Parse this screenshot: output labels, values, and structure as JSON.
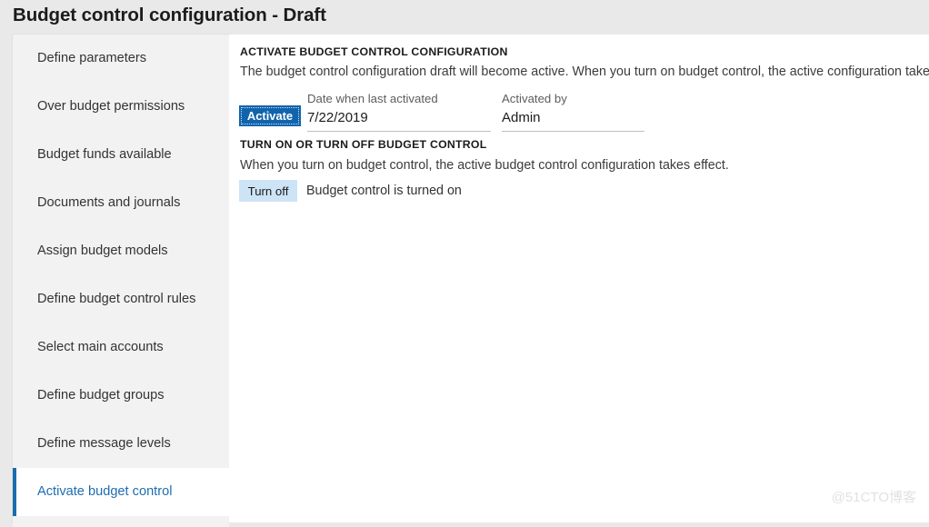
{
  "header": {
    "title": "Budget control configuration - Draft"
  },
  "sidebar": {
    "items": [
      {
        "label": "Define parameters",
        "selected": false
      },
      {
        "label": "Over budget permissions",
        "selected": false
      },
      {
        "label": "Budget funds available",
        "selected": false
      },
      {
        "label": "Documents and journals",
        "selected": false
      },
      {
        "label": "Assign budget models",
        "selected": false
      },
      {
        "label": "Define budget control rules",
        "selected": false
      },
      {
        "label": "Select main accounts",
        "selected": false
      },
      {
        "label": "Define budget groups",
        "selected": false
      },
      {
        "label": "Define message levels",
        "selected": false
      },
      {
        "label": "Activate budget control",
        "selected": true
      }
    ]
  },
  "main": {
    "activate_section": {
      "title": "ACTIVATE BUDGET CONTROL CONFIGURATION",
      "description": "The budget control configuration draft will become active. When you turn on budget control, the active configuration takes effect.",
      "activate_button": "Activate",
      "date_label": "Date when last activated",
      "date_value": "7/22/2019",
      "activated_by_label": "Activated by",
      "activated_by_value": "Admin"
    },
    "turn_section": {
      "title": "TURN ON OR TURN OFF BUDGET CONTROL",
      "description": "When you turn on budget control, the active budget control configuration takes effect.",
      "turn_off_button": "Turn off",
      "status": "Budget control is turned on"
    }
  },
  "watermark": {
    "text": "@51CTO博客"
  },
  "colors": {
    "accent": "#1164ac",
    "selected_bar": "#1a6dad",
    "selected_text": "#1f6cb0",
    "secondary_button": "#cde3f6",
    "page_background": "#e9e9e9",
    "sidebar_background": "#f2f2f2"
  }
}
